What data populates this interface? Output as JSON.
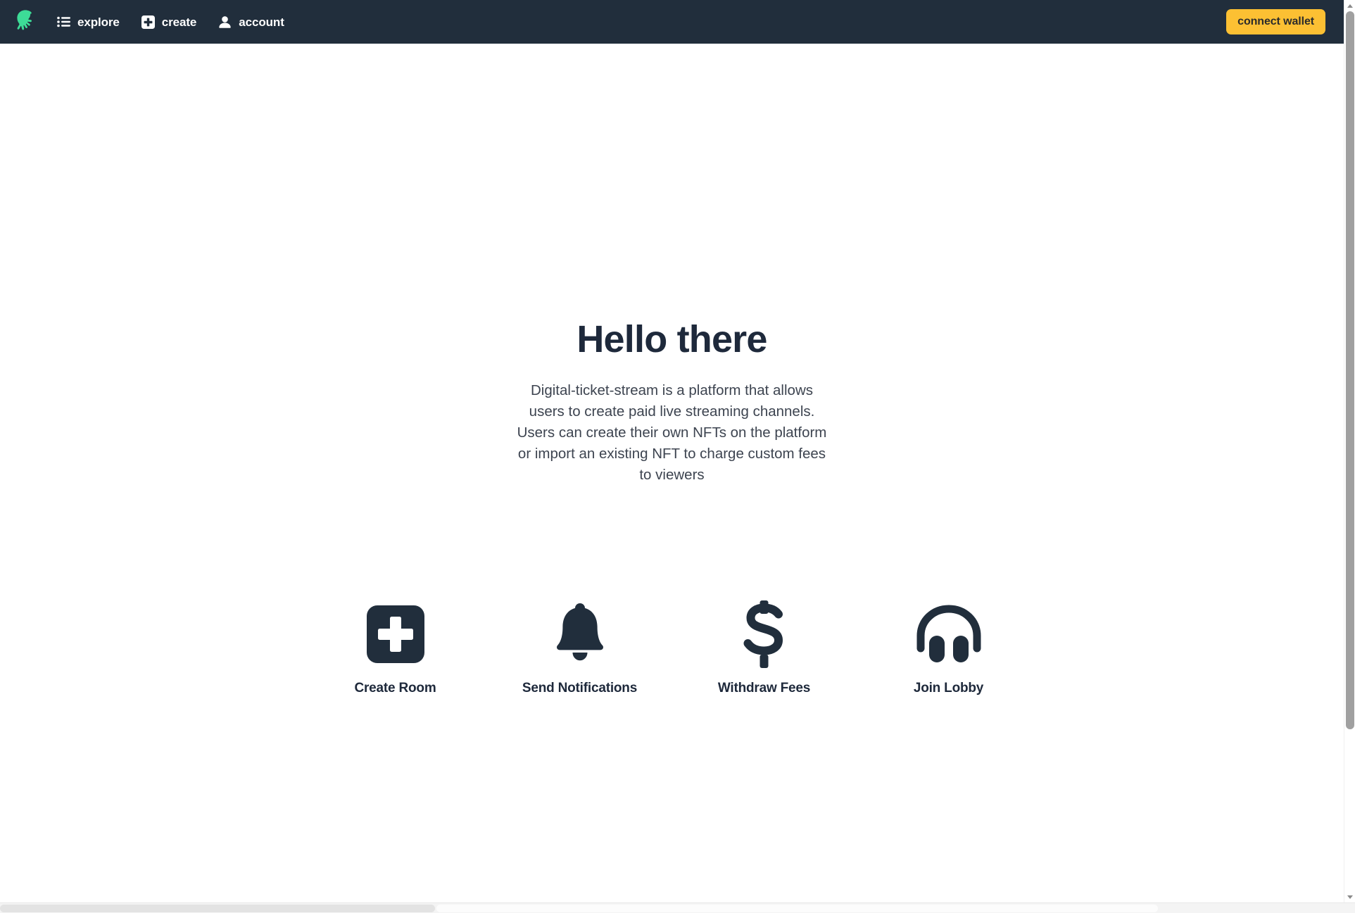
{
  "navbar": {
    "logo_icon": "octopus-logo-icon",
    "logo_color": "#3ddc97",
    "background_color": "#212e3c",
    "items": [
      {
        "label": "explore",
        "icon": "list-icon"
      },
      {
        "label": "create",
        "icon": "plus-square-icon"
      },
      {
        "label": "account",
        "icon": "person-icon"
      }
    ],
    "connect_wallet_label": "connect wallet",
    "connect_wallet_color": "#fcc033"
  },
  "hero": {
    "title": "Hello there",
    "description": "Digital-ticket-stream is a platform that allows users to create paid live streaming channels. Users can create their own NFTs on the platform or import an existing NFT to charge custom fees to viewers"
  },
  "actions": [
    {
      "label": "Create Room",
      "icon": "plus-square-icon"
    },
    {
      "label": "Send Notifications",
      "icon": "bell-icon"
    },
    {
      "label": "Withdraw Fees",
      "icon": "dollar-sign-icon"
    },
    {
      "label": "Join Lobby",
      "icon": "headphones-icon"
    }
  ],
  "theme": {
    "text_dark": "#1e293b",
    "body_text": "#3d4450",
    "page_background": "#ffffff"
  }
}
